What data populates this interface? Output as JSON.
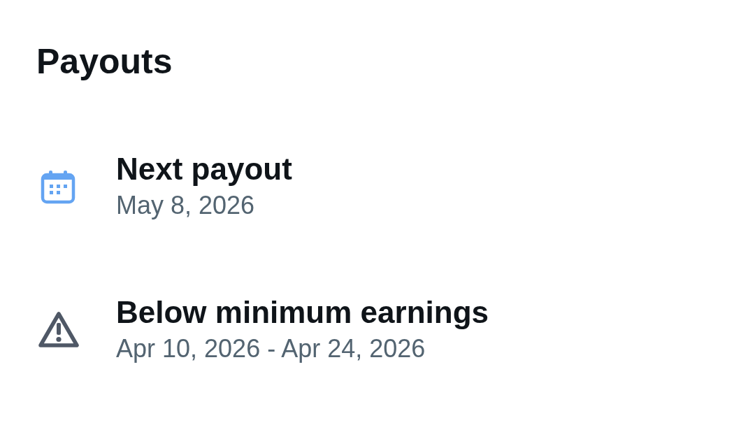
{
  "page": {
    "title": "Payouts"
  },
  "items": [
    {
      "kind": "calendar",
      "title": "Next payout",
      "subtitle": "May 8, 2026"
    },
    {
      "kind": "warning",
      "title": "Below minimum earnings",
      "subtitle": "Apr 10, 2026 - Apr 24, 2026"
    }
  ]
}
